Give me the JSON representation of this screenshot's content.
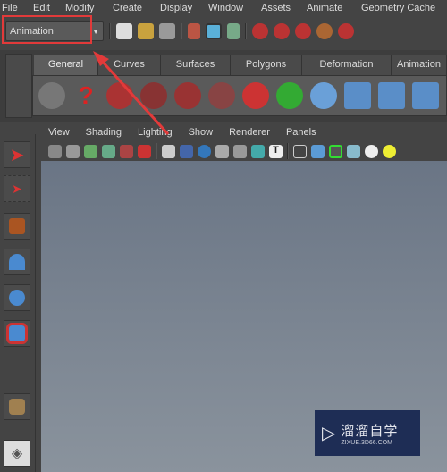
{
  "menubar": {
    "items": [
      "File",
      "Edit",
      "Modify",
      "Create",
      "Display",
      "Window",
      "Assets",
      "Animate",
      "Geometry Cache"
    ]
  },
  "toolbar": {
    "mode_selector": "Animation",
    "icons": [
      "new-scene-icon",
      "open-scene-icon",
      "save-scene-icon",
      "select-hierarchy-icon",
      "select-object-icon",
      "select-component-icon",
      "snap-grid-icon",
      "snap-curve-icon",
      "snap-point-icon",
      "snap-view-icon",
      "snap-surface-icon"
    ]
  },
  "shelf": {
    "tabs": [
      "General",
      "Curves",
      "Surfaces",
      "Polygons",
      "Deformation",
      "Animation"
    ],
    "active_tab": "General",
    "icons": [
      "movie-reel-icon",
      "help-icon",
      "camera-icon",
      "camera-aim-icon",
      "camera-aim-up-icon",
      "camera-stereo-icon",
      "undo-icon",
      "redo-icon",
      "sphere-delete-icon",
      "hierarchy-icon",
      "hierarchy2-icon",
      "hierarchy3-icon"
    ]
  },
  "toolbox": {
    "tools": [
      "select-tool-icon",
      "lasso-tool-icon",
      "paint-tool-icon",
      "move-tool-icon",
      "rotate-tool-icon",
      "scale-tool-icon",
      "cylinder-icon",
      "layout-icon"
    ]
  },
  "panel": {
    "menu": [
      "View",
      "Shading",
      "Lighting",
      "Show",
      "Renderer",
      "Panels"
    ]
  },
  "watermark": {
    "title": "溜溜自学",
    "subtitle": "ZIXUE.3D66.COM"
  },
  "colors": {
    "annotation": "#e23a3a",
    "viewport_top": "#6a7585",
    "viewport_bottom": "#8a939d"
  }
}
